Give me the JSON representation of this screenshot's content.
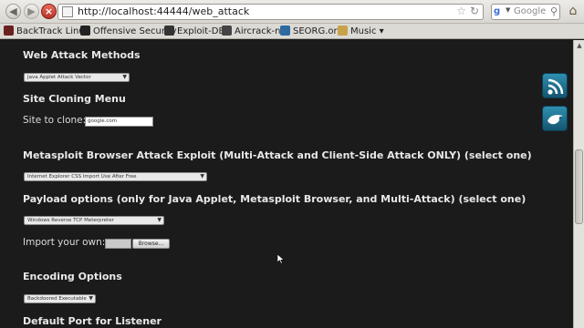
{
  "toolbar": {
    "back_icon": "back-arrow-icon",
    "forward_icon": "forward-arrow-icon",
    "stop_icon": "stop-icon",
    "url": "http://localhost:44444/web_attack",
    "search_placeholder": "Google",
    "search_engine_glyph": "g"
  },
  "bookmarks": [
    {
      "label": "BackTrack Linux",
      "icon": "dragon-icon",
      "color": "#6b2020"
    },
    {
      "label": "Offensive Security",
      "icon": "offsec-icon",
      "color": "#222222"
    },
    {
      "label": "Exploit-DB",
      "icon": "exploitdb-icon",
      "color": "#333333"
    },
    {
      "label": "Aircrack-ng",
      "icon": "aircrack-icon",
      "color": "#444444"
    },
    {
      "label": "SEORG.org",
      "icon": "seorg-icon",
      "color": "#2d6aa0"
    },
    {
      "label": "Music",
      "icon": "folder-icon",
      "color": "#c8a24a"
    }
  ],
  "page": {
    "web_attack_methods": {
      "heading": "Web Attack Methods",
      "selected": "Java Applet Attack Vector"
    },
    "site_cloning": {
      "heading": "Site Cloning Menu",
      "label": "Site to clone:",
      "value": "google.com"
    },
    "browser_exploit": {
      "heading": "Metasploit Browser Attack Exploit (Multi-Attack and Client-Side Attack ONLY) (select one)",
      "selected": "Internet Explorer CSS Import Use After Free"
    },
    "payload": {
      "heading": "Payload options (only for Java Applet, Metasploit Browser, and Multi-Attack) (select one)",
      "selected": "Windows Reverse TCP Meterpreter",
      "import_label": "Import your own:",
      "browse_label": "Browse..."
    },
    "encoding": {
      "heading": "Encoding Options",
      "selected": "Backdoored Executable"
    },
    "port": {
      "heading": "Default Port for Listener"
    }
  },
  "side_widgets": [
    {
      "icon": "rss-feed-icon"
    },
    {
      "icon": "bird-logo-icon"
    }
  ],
  "colors": {
    "page_background": "#1b1b1b",
    "heading_text": "#e8e8e8",
    "widget_blue": "#2f8fb0"
  }
}
